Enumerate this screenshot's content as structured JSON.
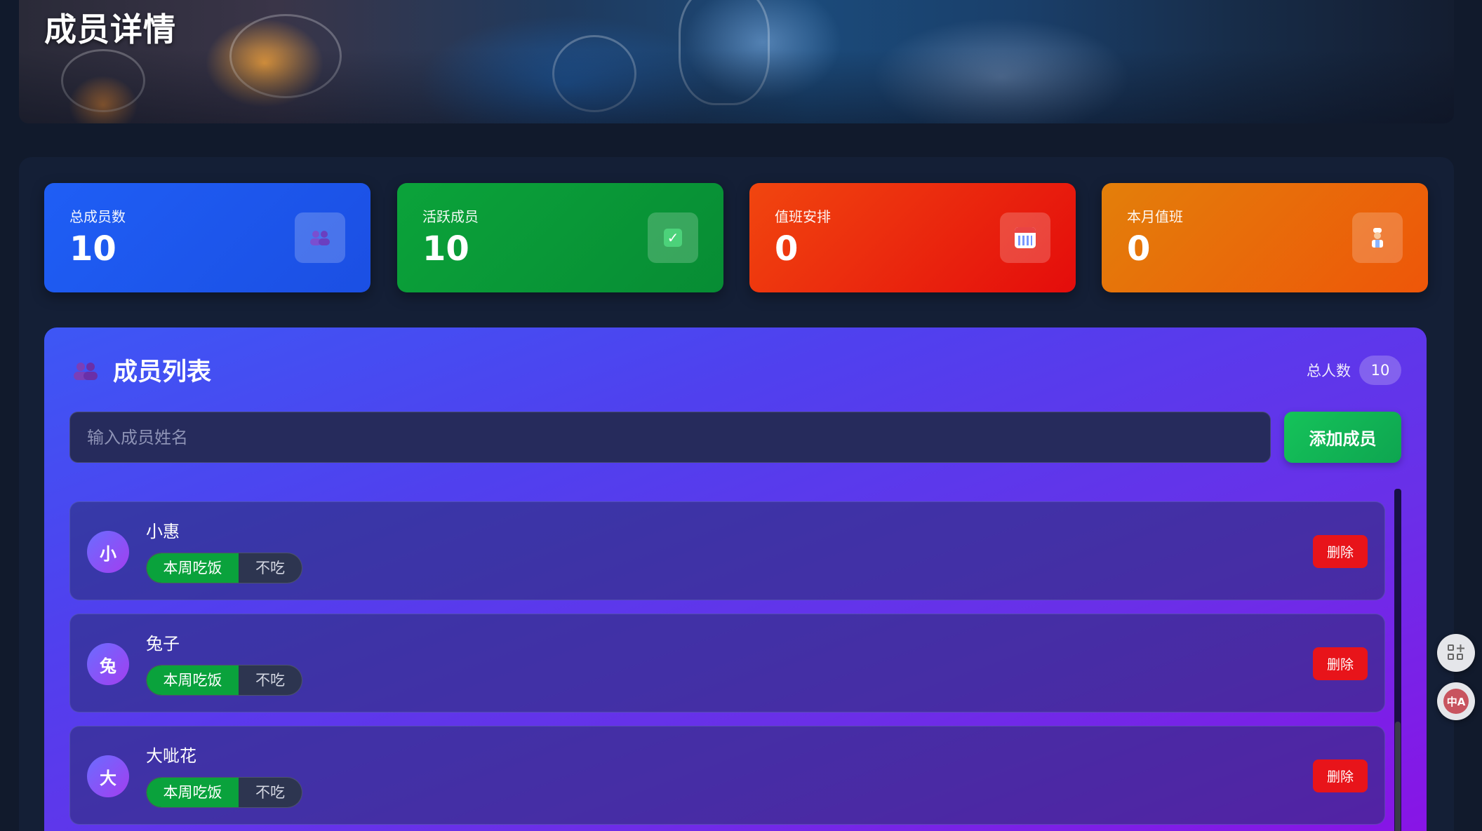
{
  "hero": {
    "title": "成员详情"
  },
  "stats": [
    {
      "label": "总成员数",
      "value": "10",
      "icon": "users-icon"
    },
    {
      "label": "活跃成员",
      "value": "10",
      "icon": "check-icon"
    },
    {
      "label": "值班安排",
      "value": "0",
      "icon": "calendar-icon"
    },
    {
      "label": "本月值班",
      "value": "0",
      "icon": "chef-icon"
    }
  ],
  "member_list": {
    "title": "成员列表",
    "total_label": "总人数",
    "total_count": "10",
    "search": {
      "placeholder": "输入成员姓名",
      "value": ""
    },
    "add_label": "添加成员",
    "members": [
      {
        "initial": "小",
        "name": "小惠",
        "eat_label": "本周吃饭",
        "skip_label": "不吃",
        "delete_label": "删除"
      },
      {
        "initial": "兔",
        "name": "兔子",
        "eat_label": "本周吃饭",
        "skip_label": "不吃",
        "delete_label": "删除"
      },
      {
        "initial": "大",
        "name": "大呲花",
        "eat_label": "本周吃饭",
        "skip_label": "不吃",
        "delete_label": "删除"
      }
    ]
  },
  "side_tools": {
    "translate_label": "中A",
    "apps_icon": "grid-plus-icon"
  },
  "colors": {
    "blue": "#1f5ef5",
    "green": "#0ba33a",
    "red": "#e40c0c",
    "orange": "#ee5609",
    "panel_start": "#3d57f5",
    "panel_end": "#8b12e6",
    "delete": "#e8141a"
  }
}
